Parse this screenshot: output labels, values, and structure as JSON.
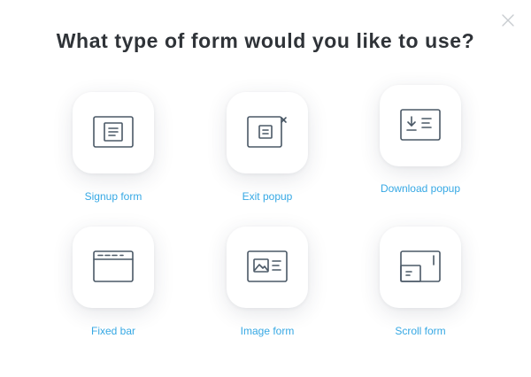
{
  "dialog": {
    "title": "What type of form would you like to use?",
    "close_icon": "close-icon"
  },
  "colors": {
    "accent": "#36a8e4",
    "title": "#2f3338",
    "icon_stroke": "#4a5866",
    "close": "#c8ccd0"
  },
  "options": [
    {
      "label": "Signup form",
      "icon": "signup-form-icon"
    },
    {
      "label": "Exit popup",
      "icon": "exit-popup-icon"
    },
    {
      "label": "Download popup",
      "icon": "download-popup-icon"
    },
    {
      "label": "Fixed bar",
      "icon": "fixed-bar-icon"
    },
    {
      "label": "Image form",
      "icon": "image-form-icon"
    },
    {
      "label": "Scroll form",
      "icon": "scroll-form-icon"
    }
  ]
}
